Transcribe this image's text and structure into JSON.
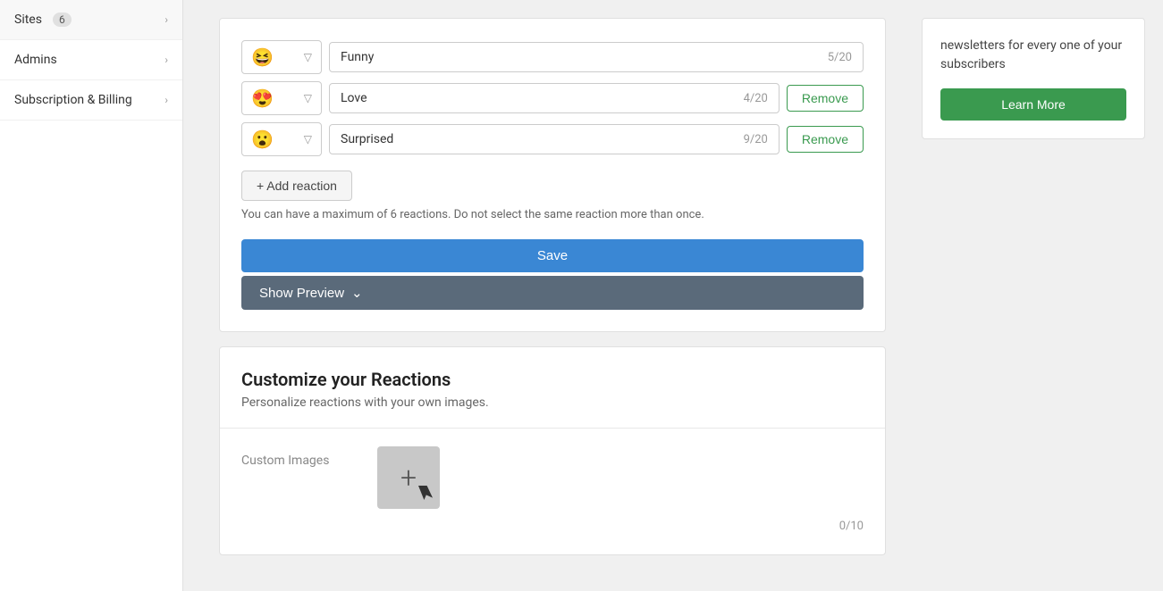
{
  "sidebar": {
    "items": [
      {
        "id": "sites",
        "label": "Sites",
        "badge": "6",
        "has_badge": true
      },
      {
        "id": "admins",
        "label": "Admins",
        "has_badge": false
      },
      {
        "id": "subscription-billing",
        "label": "Subscription & Billing",
        "has_badge": false
      }
    ]
  },
  "reactions": {
    "rows": [
      {
        "emoji": "😆",
        "label": "Funny",
        "count": "5/20",
        "has_remove": false
      },
      {
        "emoji": "😍",
        "label": "Love",
        "count": "4/20",
        "has_remove": true
      },
      {
        "emoji": "😮",
        "label": "Surprised",
        "count": "9/20",
        "has_remove": true
      }
    ],
    "add_reaction_label": "+ Add reaction",
    "hint": "You can have a maximum of 6 reactions. Do not select the same reaction more than once.",
    "save_label": "Save",
    "show_preview_label": "Show Preview"
  },
  "customize": {
    "title": "Customize your Reactions",
    "subtitle": "Personalize reactions with your own images.",
    "custom_images_label": "Custom Images",
    "image_count": "0/10"
  },
  "promo": {
    "text": "newsletters for every one of your subscribers",
    "learn_more_label": "Learn More"
  }
}
